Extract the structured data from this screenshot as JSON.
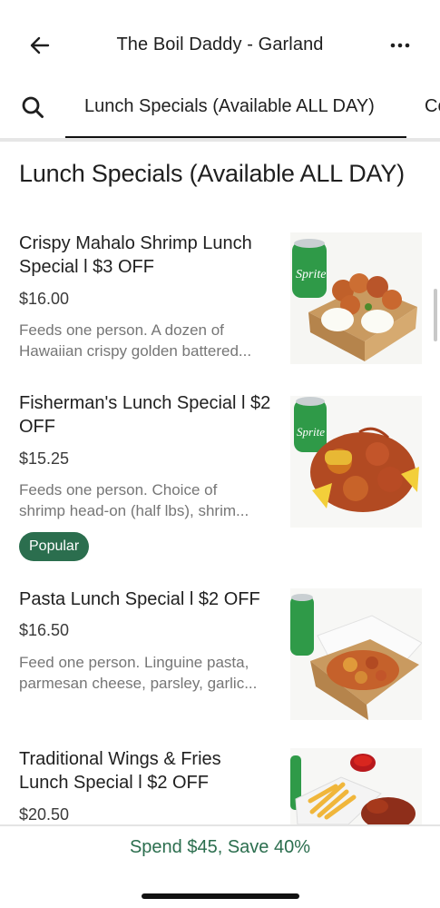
{
  "header": {
    "title": "The Boil Daddy - Garland",
    "back_icon": "arrow-left-icon",
    "more_icon": "more-horizontal-icon"
  },
  "tabs": {
    "search_icon": "search-icon",
    "active": "Lunch Specials (Available ALL DAY)",
    "next_partial": "Co"
  },
  "section": {
    "title": "Lunch Specials (Available ALL DAY)"
  },
  "items": [
    {
      "name": "Crispy Mahalo Shrimp Lunch Special l $3 OFF",
      "price": "$16.00",
      "desc_line1": "Feeds one person. A dozen of",
      "desc_line2": "Hawaiian crispy golden battered..."
    },
    {
      "name": "Fisherman's Lunch Special l $2 OFF",
      "price": "$15.25",
      "desc_line1": "Feeds one person. Choice of",
      "desc_line2": "shrimp head-on (half lbs), shrim...",
      "badge": "Popular"
    },
    {
      "name": "Pasta Lunch Special l $2 OFF",
      "price": "$16.50",
      "desc_line1": "Feed one person. Linguine pasta,",
      "desc_line2": "parmesan cheese, parsley, garlic..."
    },
    {
      "name": "Traditional Wings & Fries Lunch Special l $2 OFF",
      "price": "$20.50"
    }
  ],
  "footer": {
    "promo": "Spend $45, Save 40%"
  },
  "colors": {
    "accent_green": "#2b6e4e",
    "text_primary": "#1f1f1f",
    "text_secondary": "#767676"
  }
}
